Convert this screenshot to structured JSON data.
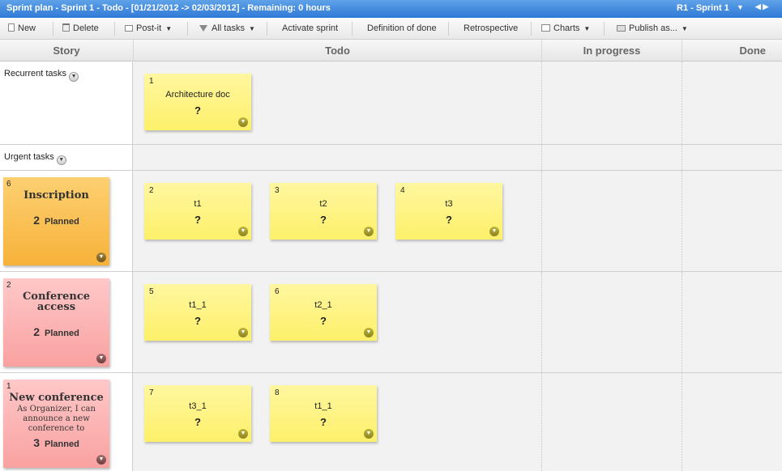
{
  "titlebar": {
    "title": "Sprint plan - Sprint 1 - Todo - [01/21/2012 -> 02/03/2012] - Remaining: 0 hours",
    "sprint": "R1 - Sprint 1",
    "caret": "▼",
    "nav": "◀ ▶"
  },
  "toolbar": {
    "new": "New",
    "delete": "Delete",
    "postit": "Post-it",
    "all_tasks": "All tasks",
    "activate_sprint": "Activate sprint",
    "definition_of_done": "Definition of done",
    "retrospective": "Retrospective",
    "charts": "Charts",
    "publish_as": "Publish as...",
    "caret": "▼"
  },
  "columns": {
    "story": "Story",
    "todo": "Todo",
    "in_progress": "In progress",
    "done": "Done"
  },
  "lanes": {
    "recurrent": {
      "label": "Recurrent tasks"
    },
    "urgent": {
      "label": "Urgent tasks"
    }
  },
  "stories": [
    {
      "num": "6",
      "title": "Inscription",
      "desc": "",
      "points": "2",
      "state": "Planned",
      "color": "#f7b23a"
    },
    {
      "num": "2",
      "title": "Conference access",
      "desc": "",
      "points": "2",
      "state": "Planned",
      "color": "#f9a1a1"
    },
    {
      "num": "1",
      "title": "New conference",
      "desc": "As Organizer, I can announce a new conference to",
      "points": "3",
      "state": "Planned",
      "color": "#f9a1a1"
    }
  ],
  "tasks": [
    {
      "num": "1",
      "name": "Architecture doc",
      "estimate": "?"
    },
    {
      "num": "2",
      "name": "t1",
      "estimate": "?"
    },
    {
      "num": "3",
      "name": "t2",
      "estimate": "?"
    },
    {
      "num": "4",
      "name": "t3",
      "estimate": "?"
    },
    {
      "num": "5",
      "name": "t1_1",
      "estimate": "?"
    },
    {
      "num": "6",
      "name": "t2_1",
      "estimate": "?"
    },
    {
      "num": "7",
      "name": "t3_1",
      "estimate": "?"
    },
    {
      "num": "8",
      "name": "t1_1",
      "estimate": "?"
    }
  ],
  "icons": {
    "menu_chevron": "⌄",
    "colors": {
      "titlebar": "#2f79d6",
      "postit": "#fdf06a"
    }
  }
}
